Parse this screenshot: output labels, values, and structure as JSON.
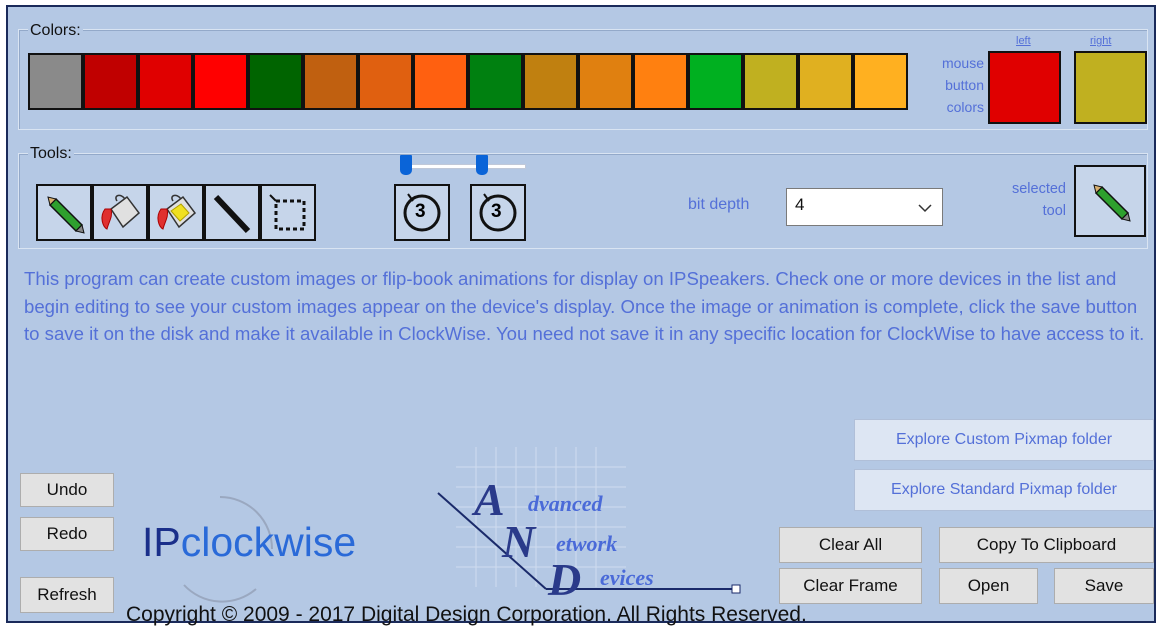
{
  "colors_group": {
    "label": "Colors:"
  },
  "palette": [
    "#8a8a8a",
    "#c00000",
    "#e00000",
    "#ff0000",
    "#006400",
    "#c06010",
    "#e06010",
    "#ff6010",
    "#008010",
    "#c08010",
    "#e08010",
    "#ff8010",
    "#00b020",
    "#c0b020",
    "#e0b020",
    "#ffb020"
  ],
  "mouse_buttons": {
    "label_lines": [
      "mouse",
      "button",
      "colors"
    ],
    "left": {
      "label": "left",
      "color": "#e00000"
    },
    "right": {
      "label": "right",
      "color": "#c0b020"
    }
  },
  "tools_group": {
    "label": "Tools:",
    "tools": [
      "pencil-icon",
      "paint-bucket-icon",
      "paint-bucket-outline-icon",
      "line-icon",
      "select-rectangle-icon"
    ],
    "size_dials": [
      {
        "value": "3",
        "slider": 0.0
      },
      {
        "value": "3",
        "slider": 0.0
      }
    ],
    "bit_depth_label": "bit depth",
    "bit_depth_value": "4",
    "selected_tool_label_lines": [
      "selected",
      "tool"
    ],
    "selected_tool_icon": "pencil-icon"
  },
  "description": "This program can create custom images or flip-book animations for display on IPSpeakers.  Check one or more devices in the list and begin editing to see your custom images appear on the device's display.  Once the image or animation is complete, click the save button to save it on the disk and make it available in ClockWise.  You need not save it in any specific location for ClockWise to have access to it.",
  "buttons": {
    "undo": "Undo",
    "redo": "Redo",
    "refresh": "Refresh",
    "explore_custom": "Explore Custom Pixmap folder",
    "explore_standard": "Explore Standard Pixmap folder",
    "clear_all": "Clear All",
    "copy_clipboard": "Copy To Clipboard",
    "clear_frame": "Clear Frame",
    "open": "Open",
    "save": "Save"
  },
  "logos": {
    "ipclockwise_ip": "IP",
    "ipclockwise_rest": "clockwise",
    "and": {
      "line1": "dvanced",
      "line2": "etwork",
      "line3": "evices",
      "a": "A",
      "n": "N",
      "d": "D"
    }
  },
  "copyright": "Copyright © 2009 - 2017 Digital Design Corporation.  All Rights Reserved."
}
